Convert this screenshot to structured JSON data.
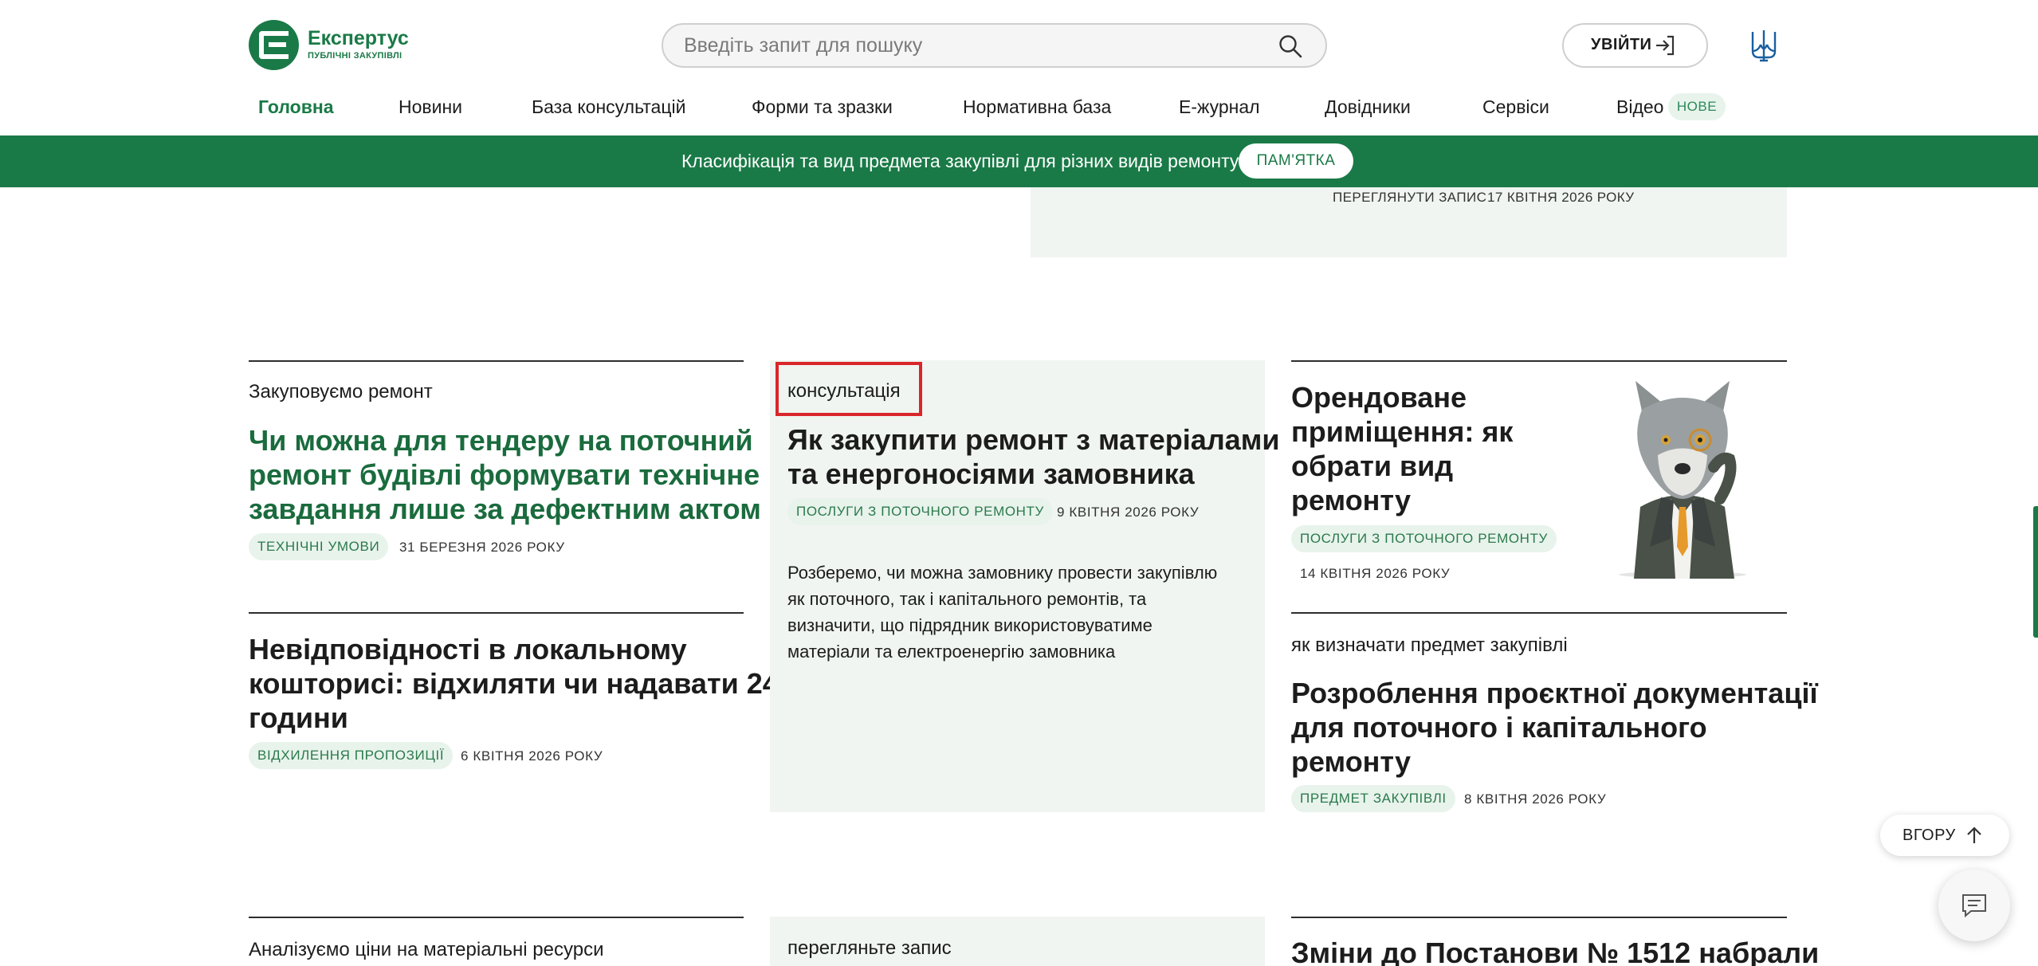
{
  "header": {
    "logo_title": "Експертус",
    "logo_subtitle": "ПУБЛІЧНІ ЗАКУПІВЛІ",
    "search_placeholder": "Введіть запит для пошуку",
    "login_label": "УВІЙТИ"
  },
  "nav": {
    "items": [
      {
        "label": "Головна"
      },
      {
        "label": "Новини"
      },
      {
        "label": "База консультацій"
      },
      {
        "label": "Форми та зразки"
      },
      {
        "label": "Нормативна база"
      },
      {
        "label": "Е-журнал"
      },
      {
        "label": "Довідники"
      },
      {
        "label": "Сервіси"
      },
      {
        "label": "Відео"
      }
    ],
    "new_badge": "НОВЕ"
  },
  "banner": {
    "text": "Класифікація та вид предмета закупівлі для різних видів ремонту",
    "button_label": "ПАМ'ЯТКА"
  },
  "top_card": {
    "link": "ПЕРЕГЛЯНУТИ ЗАПИС",
    "date": "17 КВІТНЯ 2026 РОКУ"
  },
  "articles": {
    "a1": {
      "category": "Закуповуємо ремонт",
      "title_lines": [
        "Чи можна для тендеру на поточний",
        "ремонт будівлі формувати технічне",
        "завдання лише за дефектним актом"
      ],
      "tag": "ТЕХНІЧНІ УМОВИ",
      "date": "31 БЕРЕЗНЯ 2026 РОКУ"
    },
    "a2": {
      "title_lines": [
        "Невідповідності в локальному",
        "кошторисі: відхиляти чи надавати 24",
        "години"
      ],
      "tag": "ВІДХИЛЕННЯ ПРОПОЗИЦІЇ",
      "date": "6 КВІТНЯ 2026 РОКУ"
    },
    "featured": {
      "category": "консультація",
      "title_lines": [
        "Як закупити ремонт з матеріалами",
        "та енергоносіями замовника"
      ],
      "tag": "ПОСЛУГИ З ПОТОЧНОГО РЕМОНТУ",
      "date": "9 КВІТНЯ 2026 РОКУ",
      "excerpt_lines": [
        "Розберемо, чи можна замовнику провести закупівлю",
        "як поточного, так і капітального ремонтів, та",
        "визначити, що підрядник використовуватиме",
        "матеріали та електроенергію замовника"
      ]
    },
    "a3": {
      "title_lines": [
        "Орендоване",
        "приміщення: як",
        "обрати вид",
        "ремонту"
      ],
      "tag": "ПОСЛУГИ З ПОТОЧНОГО РЕМОНТУ",
      "date": "14 КВІТНЯ 2026 РОКУ"
    },
    "a4": {
      "category": "як визначати предмет закупівлі",
      "title_lines": [
        "Розроблення проєктної документації",
        "для поточного і капітального",
        "ремонту"
      ],
      "tag": "ПРЕДМЕТ ЗАКУПІВЛІ",
      "date": "8 КВІТНЯ 2026 РОКУ"
    }
  },
  "bottom_row": {
    "left_category": "Аналізуємо ціни на матеріальні ресурси",
    "middle_category": "перегляньте запис",
    "right_title": "Зміни до Постанови № 1512 набрали"
  },
  "controls": {
    "up_label": "ВГОРУ"
  },
  "colors": {
    "brand_green": "#1a7a47",
    "highlight_red": "#d9262a",
    "card_bg": "#f0f5f1"
  }
}
